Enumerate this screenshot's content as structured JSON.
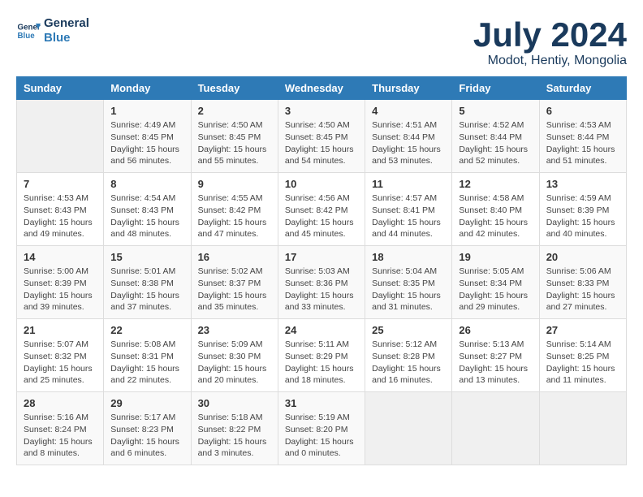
{
  "logo": {
    "line1": "General",
    "line2": "Blue"
  },
  "title": "July 2024",
  "subtitle": "Modot, Hentiy, Mongolia",
  "days_header": [
    "Sunday",
    "Monday",
    "Tuesday",
    "Wednesday",
    "Thursday",
    "Friday",
    "Saturday"
  ],
  "weeks": [
    [
      {
        "day": "",
        "info": ""
      },
      {
        "day": "1",
        "info": "Sunrise: 4:49 AM\nSunset: 8:45 PM\nDaylight: 15 hours\nand 56 minutes."
      },
      {
        "day": "2",
        "info": "Sunrise: 4:50 AM\nSunset: 8:45 PM\nDaylight: 15 hours\nand 55 minutes."
      },
      {
        "day": "3",
        "info": "Sunrise: 4:50 AM\nSunset: 8:45 PM\nDaylight: 15 hours\nand 54 minutes."
      },
      {
        "day": "4",
        "info": "Sunrise: 4:51 AM\nSunset: 8:44 PM\nDaylight: 15 hours\nand 53 minutes."
      },
      {
        "day": "5",
        "info": "Sunrise: 4:52 AM\nSunset: 8:44 PM\nDaylight: 15 hours\nand 52 minutes."
      },
      {
        "day": "6",
        "info": "Sunrise: 4:53 AM\nSunset: 8:44 PM\nDaylight: 15 hours\nand 51 minutes."
      }
    ],
    [
      {
        "day": "7",
        "info": "Sunrise: 4:53 AM\nSunset: 8:43 PM\nDaylight: 15 hours\nand 49 minutes."
      },
      {
        "day": "8",
        "info": "Sunrise: 4:54 AM\nSunset: 8:43 PM\nDaylight: 15 hours\nand 48 minutes."
      },
      {
        "day": "9",
        "info": "Sunrise: 4:55 AM\nSunset: 8:42 PM\nDaylight: 15 hours\nand 47 minutes."
      },
      {
        "day": "10",
        "info": "Sunrise: 4:56 AM\nSunset: 8:42 PM\nDaylight: 15 hours\nand 45 minutes."
      },
      {
        "day": "11",
        "info": "Sunrise: 4:57 AM\nSunset: 8:41 PM\nDaylight: 15 hours\nand 44 minutes."
      },
      {
        "day": "12",
        "info": "Sunrise: 4:58 AM\nSunset: 8:40 PM\nDaylight: 15 hours\nand 42 minutes."
      },
      {
        "day": "13",
        "info": "Sunrise: 4:59 AM\nSunset: 8:39 PM\nDaylight: 15 hours\nand 40 minutes."
      }
    ],
    [
      {
        "day": "14",
        "info": "Sunrise: 5:00 AM\nSunset: 8:39 PM\nDaylight: 15 hours\nand 39 minutes."
      },
      {
        "day": "15",
        "info": "Sunrise: 5:01 AM\nSunset: 8:38 PM\nDaylight: 15 hours\nand 37 minutes."
      },
      {
        "day": "16",
        "info": "Sunrise: 5:02 AM\nSunset: 8:37 PM\nDaylight: 15 hours\nand 35 minutes."
      },
      {
        "day": "17",
        "info": "Sunrise: 5:03 AM\nSunset: 8:36 PM\nDaylight: 15 hours\nand 33 minutes."
      },
      {
        "day": "18",
        "info": "Sunrise: 5:04 AM\nSunset: 8:35 PM\nDaylight: 15 hours\nand 31 minutes."
      },
      {
        "day": "19",
        "info": "Sunrise: 5:05 AM\nSunset: 8:34 PM\nDaylight: 15 hours\nand 29 minutes."
      },
      {
        "day": "20",
        "info": "Sunrise: 5:06 AM\nSunset: 8:33 PM\nDaylight: 15 hours\nand 27 minutes."
      }
    ],
    [
      {
        "day": "21",
        "info": "Sunrise: 5:07 AM\nSunset: 8:32 PM\nDaylight: 15 hours\nand 25 minutes."
      },
      {
        "day": "22",
        "info": "Sunrise: 5:08 AM\nSunset: 8:31 PM\nDaylight: 15 hours\nand 22 minutes."
      },
      {
        "day": "23",
        "info": "Sunrise: 5:09 AM\nSunset: 8:30 PM\nDaylight: 15 hours\nand 20 minutes."
      },
      {
        "day": "24",
        "info": "Sunrise: 5:11 AM\nSunset: 8:29 PM\nDaylight: 15 hours\nand 18 minutes."
      },
      {
        "day": "25",
        "info": "Sunrise: 5:12 AM\nSunset: 8:28 PM\nDaylight: 15 hours\nand 16 minutes."
      },
      {
        "day": "26",
        "info": "Sunrise: 5:13 AM\nSunset: 8:27 PM\nDaylight: 15 hours\nand 13 minutes."
      },
      {
        "day": "27",
        "info": "Sunrise: 5:14 AM\nSunset: 8:25 PM\nDaylight: 15 hours\nand 11 minutes."
      }
    ],
    [
      {
        "day": "28",
        "info": "Sunrise: 5:16 AM\nSunset: 8:24 PM\nDaylight: 15 hours\nand 8 minutes."
      },
      {
        "day": "29",
        "info": "Sunrise: 5:17 AM\nSunset: 8:23 PM\nDaylight: 15 hours\nand 6 minutes."
      },
      {
        "day": "30",
        "info": "Sunrise: 5:18 AM\nSunset: 8:22 PM\nDaylight: 15 hours\nand 3 minutes."
      },
      {
        "day": "31",
        "info": "Sunrise: 5:19 AM\nSunset: 8:20 PM\nDaylight: 15 hours\nand 0 minutes."
      },
      {
        "day": "",
        "info": ""
      },
      {
        "day": "",
        "info": ""
      },
      {
        "day": "",
        "info": ""
      }
    ]
  ]
}
